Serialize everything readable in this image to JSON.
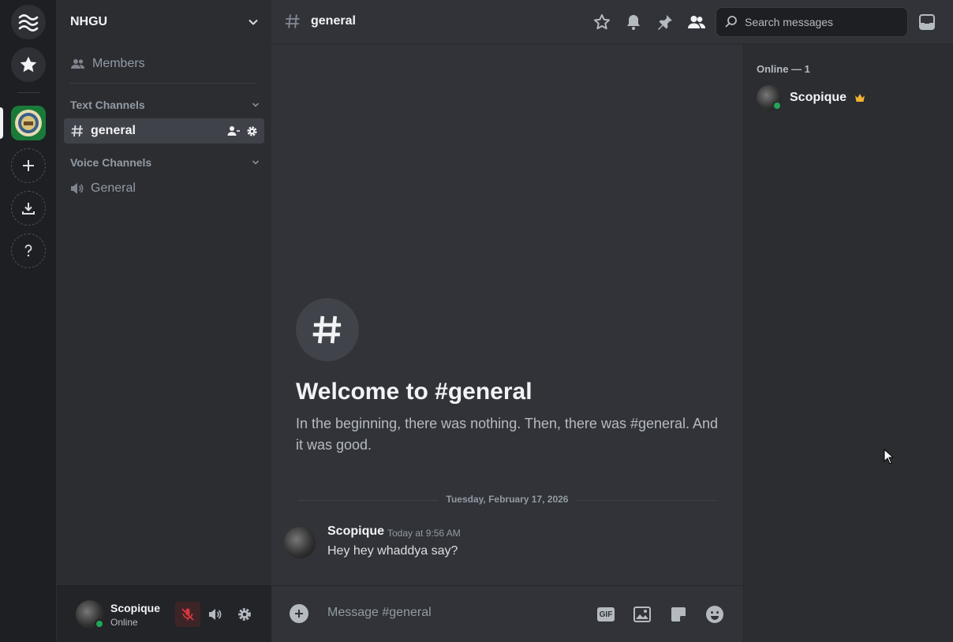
{
  "rail": {
    "home_icon": "waves-logo-icon",
    "favorites_icon": "star-icon",
    "guild_icon": "server-seal-icon",
    "add_icon": "plus-icon",
    "download_icon": "download-icon",
    "help_icon": "question-icon"
  },
  "sidebar": {
    "server_name": "NHGU",
    "members_label": "Members",
    "text_category": "Text Channels",
    "voice_category": "Voice Channels",
    "text_channels": [
      {
        "name": "general",
        "active": true
      }
    ],
    "voice_channels": [
      {
        "name": "General"
      }
    ]
  },
  "user_panel": {
    "username": "Scopique",
    "status": "Online"
  },
  "header": {
    "channel_name": "general",
    "search_placeholder": "Search messages"
  },
  "welcome": {
    "title": "Welcome to #general",
    "description": "In the beginning, there was nothing. Then, there was #general. And it was good."
  },
  "messages": {
    "date_divider": "Tuesday, February 17, 2026",
    "items": [
      {
        "author": "Scopique",
        "time": "Today at 9:56 AM",
        "text": "Hey hey whaddya say?"
      }
    ]
  },
  "composer": {
    "placeholder": "Message #general",
    "gif_label": "GIF"
  },
  "members_pane": {
    "header": "Online — 1",
    "members": [
      {
        "name": "Scopique",
        "badge": "crown-icon",
        "status": "online"
      }
    ]
  },
  "colors": {
    "accent_online": "#23a55a",
    "muted_red": "#da373c",
    "crown": "#f0b232"
  }
}
